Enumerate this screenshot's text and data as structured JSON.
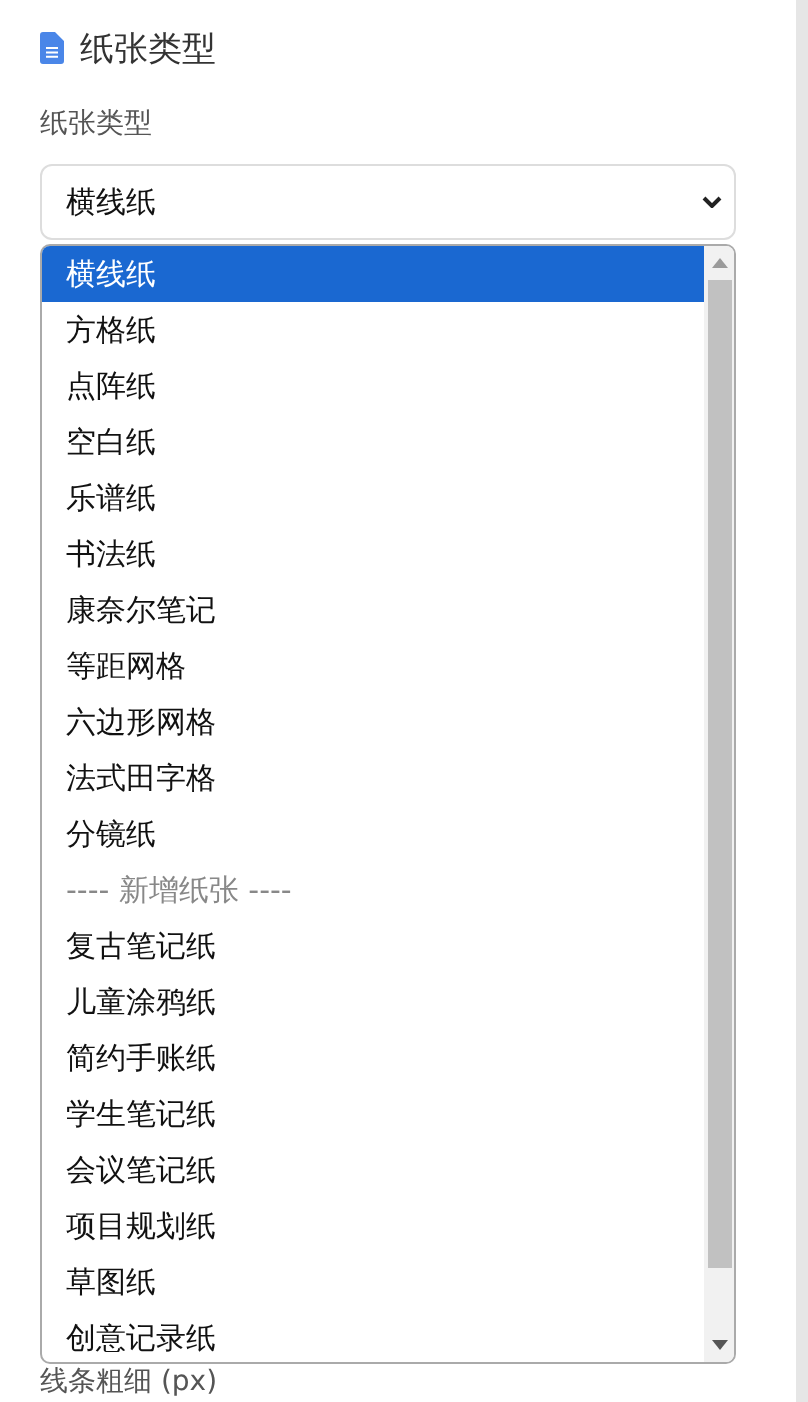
{
  "section": {
    "title": "纸张类型"
  },
  "field": {
    "label": "纸张类型",
    "value": "横线纸"
  },
  "dropdown": {
    "items": [
      {
        "kind": "option",
        "label": "横线纸",
        "selected": true
      },
      {
        "kind": "option",
        "label": "方格纸",
        "selected": false
      },
      {
        "kind": "option",
        "label": "点阵纸",
        "selected": false
      },
      {
        "kind": "option",
        "label": "空白纸",
        "selected": false
      },
      {
        "kind": "option",
        "label": "乐谱纸",
        "selected": false
      },
      {
        "kind": "option",
        "label": "书法纸",
        "selected": false
      },
      {
        "kind": "option",
        "label": "康奈尔笔记",
        "selected": false
      },
      {
        "kind": "option",
        "label": "等距网格",
        "selected": false
      },
      {
        "kind": "option",
        "label": "六边形网格",
        "selected": false
      },
      {
        "kind": "option",
        "label": "法式田字格",
        "selected": false
      },
      {
        "kind": "option",
        "label": "分镜纸",
        "selected": false
      },
      {
        "kind": "separator",
        "label": "---- 新增纸张 ----"
      },
      {
        "kind": "option",
        "label": "复古笔记纸",
        "selected": false
      },
      {
        "kind": "option",
        "label": "儿童涂鸦纸",
        "selected": false
      },
      {
        "kind": "option",
        "label": "简约手账纸",
        "selected": false
      },
      {
        "kind": "option",
        "label": "学生笔记纸",
        "selected": false
      },
      {
        "kind": "option",
        "label": "会议笔记纸",
        "selected": false
      },
      {
        "kind": "option",
        "label": "项目规划纸",
        "selected": false
      },
      {
        "kind": "option",
        "label": "草图纸",
        "selected": false
      },
      {
        "kind": "option",
        "label": "创意记录纸",
        "selected": false
      }
    ]
  },
  "next_field": {
    "label": "线条粗细 (px)"
  }
}
